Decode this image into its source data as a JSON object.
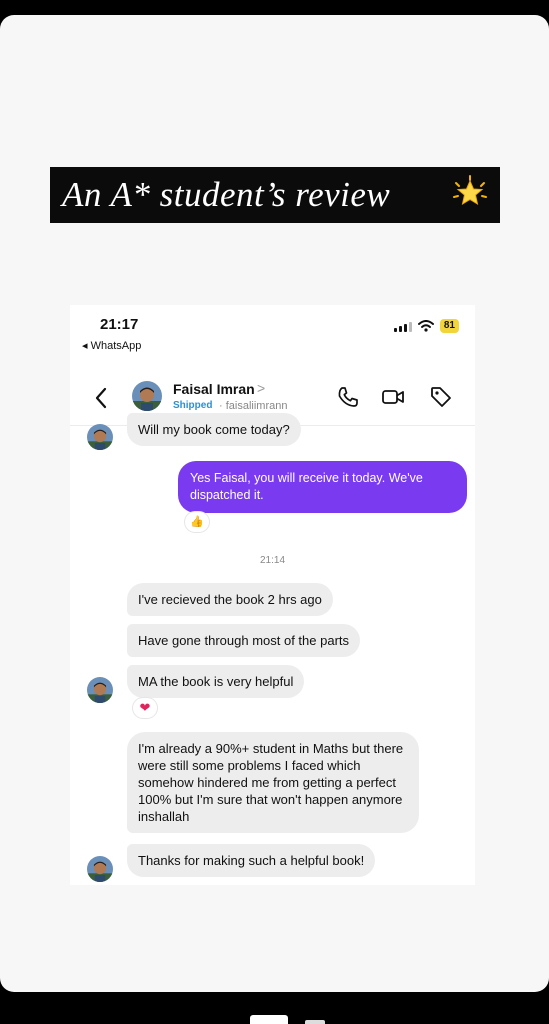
{
  "banner": {
    "title": "An A* student’s review",
    "star": "glowing-star"
  },
  "status": {
    "time": "21:17",
    "back_label": "◂ WhatsApp",
    "battery": "81"
  },
  "contact": {
    "name": "Faisal Imran",
    "chevron": ">",
    "status": "Shipped",
    "handle": "· faisaliimrann"
  },
  "messages": {
    "m1": "Will my book come today?",
    "m2": "Yes Faisal, you will receive it today. We've dispatched it.",
    "timestamp": "21:14",
    "m3": "I've recieved the book 2 hrs ago",
    "m4": "Have gone through most of the parts",
    "m5": "MA the book is very helpful",
    "m6": "I'm already a 90%+ student in Maths but there were still some problems I faced which somehow hindered me from getting a perfect 100% but I'm sure that won't happen anymore inshallah",
    "m7": "Thanks for making such a helpful book!"
  },
  "reactions": {
    "r1": "👍",
    "r2": "❤"
  },
  "colors": {
    "outgoing": "#7a3af0",
    "incoming": "#ededed",
    "banner_bg": "#0b0b0b",
    "shipped": "#2b8fd6"
  }
}
